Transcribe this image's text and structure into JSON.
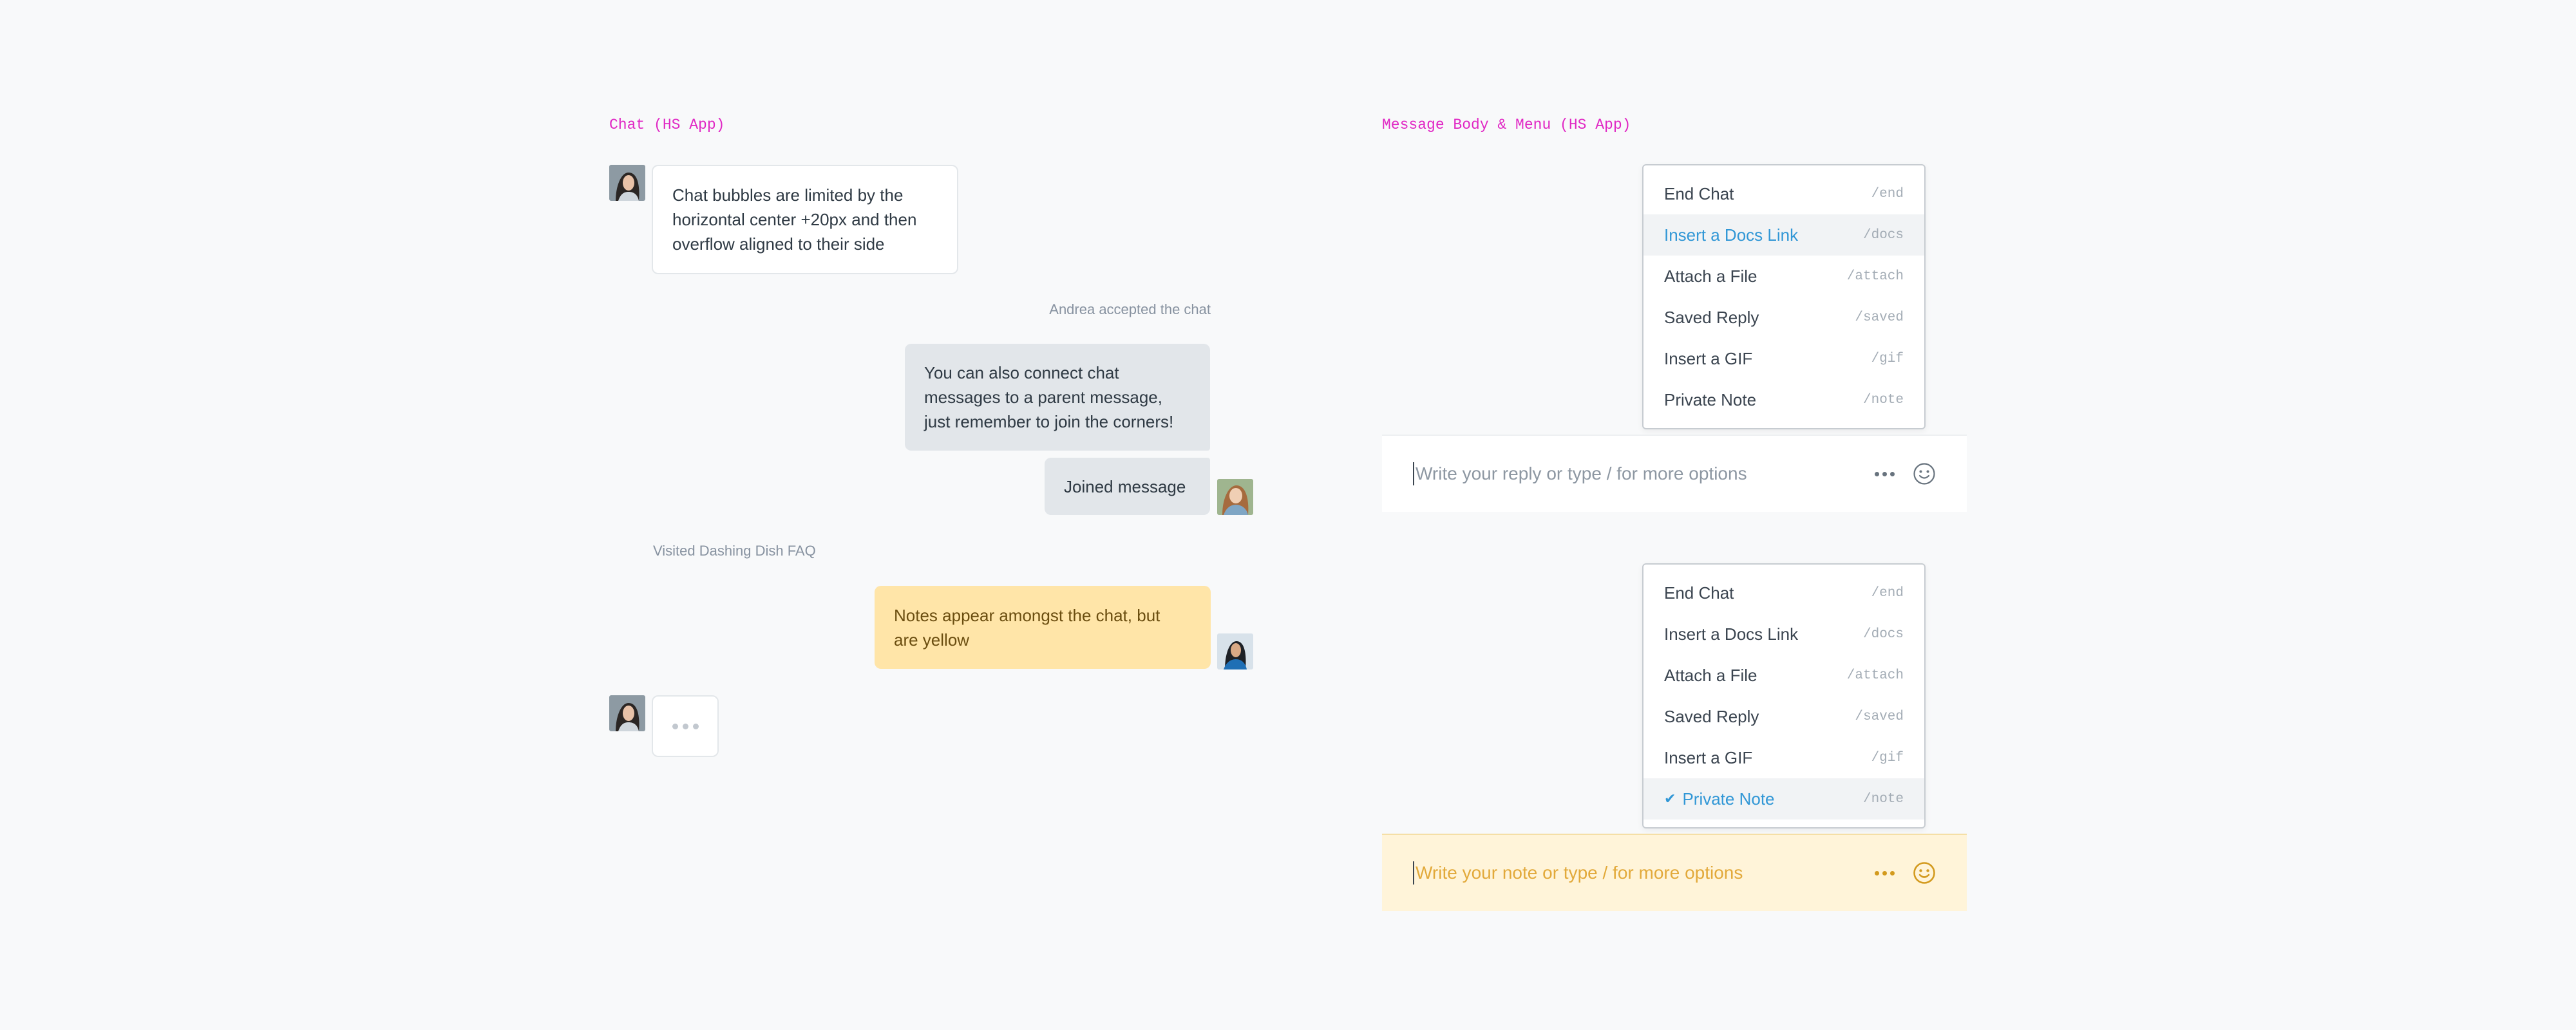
{
  "chat": {
    "title": "Chat (HS App)",
    "customer_bubble": "Chat bubbles are limited by the\nhorizontal center +20px and then\noverflow aligned to their side",
    "accepted_text": "Andrea accepted the chat",
    "agent_bubble": "You can also connect chat\nmessages to a parent message,\njust remember to join the corners!",
    "joined_bubble": "Joined message",
    "visited_text": "Visited Dashing Dish FAQ",
    "note_bubble": "Notes appear amongst the chat, but\nare yellow"
  },
  "message_body": {
    "title": "Message Body & Menu (HS App)",
    "menu1": {
      "items": [
        {
          "label": "End Chat",
          "cmd": "/end"
        },
        {
          "label": "Insert a Docs Link",
          "cmd": "/docs"
        },
        {
          "label": "Attach a File",
          "cmd": "/attach"
        },
        {
          "label": "Saved Reply",
          "cmd": "/saved"
        },
        {
          "label": "Insert a GIF",
          "cmd": "/gif"
        },
        {
          "label": "Private Note",
          "cmd": "/note"
        }
      ]
    },
    "reply_placeholder": "Write your reply or type / for more options",
    "menu2": {
      "items": [
        {
          "label": "End Chat",
          "cmd": "/end"
        },
        {
          "label": "Insert a Docs Link",
          "cmd": "/docs"
        },
        {
          "label": "Attach a File",
          "cmd": "/attach"
        },
        {
          "label": "Saved Reply",
          "cmd": "/saved"
        },
        {
          "label": "Insert a GIF",
          "cmd": "/gif"
        },
        {
          "label": "Private Note",
          "cmd": "/note"
        }
      ]
    },
    "note_placeholder": "Write your note or type / for more options"
  },
  "colors": {
    "section_title": "#e027c4",
    "active_item": "#3197d6",
    "note_bubble": "#ffe5a8",
    "note_composer": "#fff4d9",
    "agent_bubble": "#e2e6ea"
  },
  "icons": [
    "checkmark-icon",
    "more-options-icon",
    "emoji-icon"
  ]
}
